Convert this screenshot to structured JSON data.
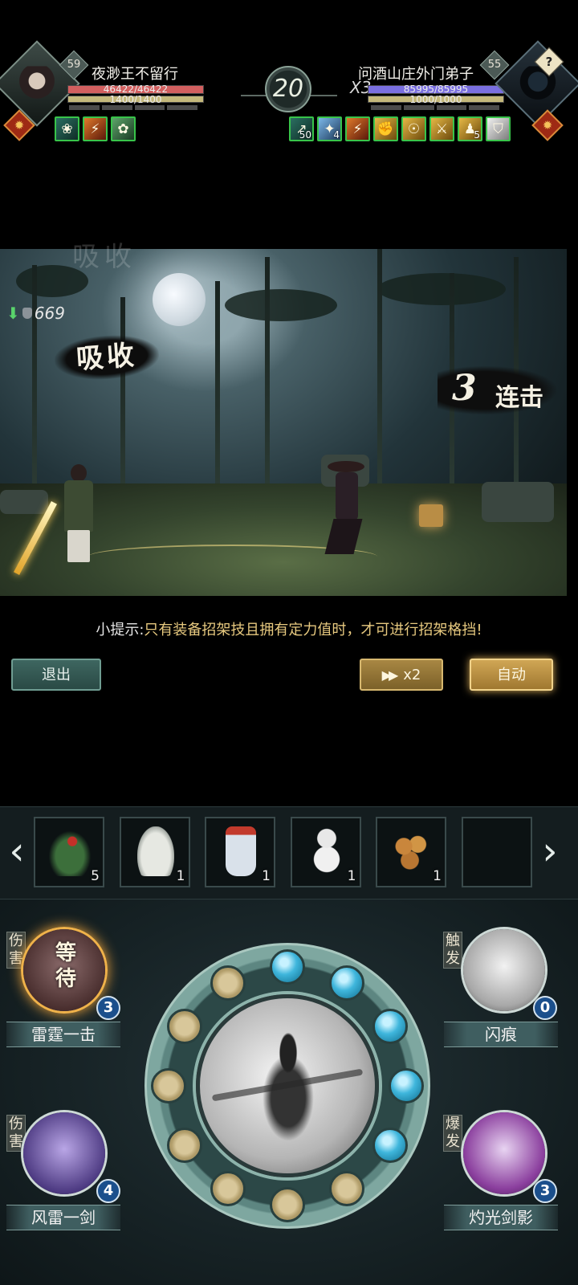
{
  "player": {
    "level": "59",
    "name": "夜渺王不留行",
    "hp_text": "46422/46422",
    "hp_fraction": 1.0,
    "sp_text": "1400/1400",
    "sp_fraction": 1.0,
    "buffs": [
      {
        "icon": "lotus-icon",
        "glyph": "❀"
      },
      {
        "icon": "claw-slash-icon",
        "glyph": "⚡"
      },
      {
        "icon": "jade-icon",
        "glyph": "✿"
      }
    ]
  },
  "enemy": {
    "level": "55",
    "name": "问酒山庄外门弟子",
    "multiplier": "X3",
    "hp_text": "85995/85995",
    "hp_fraction": 1.0,
    "sp_text": "1000/1000",
    "sp_fraction": 1.0,
    "help_glyph": "?",
    "buffs": [
      {
        "icon": "arrow-up-icon",
        "glyph": "↗",
        "count": "50"
      },
      {
        "icon": "water-drop-icon",
        "glyph": "✦",
        "count": "4"
      },
      {
        "icon": "claw-slash-icon",
        "glyph": "⚡",
        "count": ""
      },
      {
        "icon": "fist-icon",
        "glyph": "✊",
        "count": ""
      },
      {
        "icon": "meditate-icon",
        "glyph": "☉",
        "count": ""
      },
      {
        "icon": "double-slash-icon",
        "glyph": "⚔",
        "count": ""
      },
      {
        "icon": "stance-icon",
        "glyph": "♟",
        "count": "5"
      },
      {
        "icon": "shield-icon",
        "glyph": "⛉",
        "count": ""
      }
    ]
  },
  "round": "20",
  "sun_glyph": "✹",
  "battle": {
    "watermark": "吸收",
    "absorb_value": "669",
    "absorb_label": "吸收",
    "combo_number": "3",
    "combo_word": "连击"
  },
  "tip": {
    "prefix": "小提示:",
    "text": "只有装备招架技且拥有定力值时，才可进行招架格挡!"
  },
  "buttons": {
    "exit": "退出",
    "speed": "x2",
    "auto": "自动"
  },
  "items": [
    {
      "icon": "herb-icon",
      "qty": "5"
    },
    {
      "icon": "medicine-jar-icon",
      "qty": "1"
    },
    {
      "icon": "potion-bottle-icon",
      "qty": "1"
    },
    {
      "icon": "gourd-icon",
      "qty": "1"
    },
    {
      "icon": "copper-coins-icon",
      "qty": "1"
    },
    {
      "icon": "empty-slot",
      "qty": ""
    }
  ],
  "skills": [
    {
      "tag": "伤害",
      "name": "雷霆一击",
      "count": "3",
      "status": "等待"
    },
    {
      "tag": "伤害",
      "name": "风雷一剑",
      "count": "4"
    },
    {
      "tag": "触发",
      "name": "闪痕",
      "count": "0"
    },
    {
      "tag": "爆发",
      "name": "灼光剑影",
      "count": "3"
    }
  ],
  "energy": {
    "filled": 5,
    "total": 12
  },
  "colors": {
    "player_hp": "#d25f5f",
    "enemy_hp": "#7a6fe0",
    "stamina": "#c4b87b",
    "buff_border": "#38c44a",
    "energy_on": "#3fb6dc"
  }
}
